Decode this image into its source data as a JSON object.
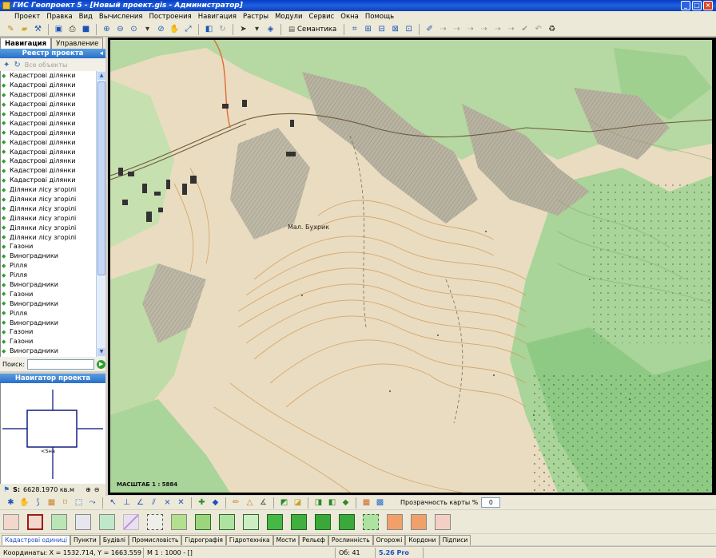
{
  "window": {
    "title": "ГИС Геопроект 5 - [Новый проект.gis - Администратор]"
  },
  "menu": [
    "Проект",
    "Правка",
    "Вид",
    "Вычисления",
    "Построения",
    "Навигация",
    "Растры",
    "Модули",
    "Сервис",
    "Окна",
    "Помощь"
  ],
  "toolbar": {
    "semantic_label": "Семантика"
  },
  "left_tabs": {
    "nav": "Навигация",
    "manage": "Управление"
  },
  "registry": {
    "header": "Реестр проекта",
    "all_objects": "Все объекты",
    "items": [
      "Кадастрові ділянки",
      "Кадастрові ділянки",
      "Кадастрові ділянки",
      "Кадастрові ділянки",
      "Кадастрові ділянки",
      "Кадастрові ділянки",
      "Кадастрові ділянки",
      "Кадастрові ділянки",
      "Кадастрові ділянки",
      "Кадастрові ділянки",
      "Кадастрові ділянки",
      "Кадастрові ділянки",
      "Ділянки лісу згорілі",
      "Ділянки лісу згорілі",
      "Ділянки лісу згорілі",
      "Ділянки лісу згорілі",
      "Ділянки лісу згорілі",
      "Ділянки лісу згорілі",
      "Газони",
      "Виноградники",
      "Рілля",
      "Рілля",
      "Виноградники",
      "Газони",
      "Виноградники",
      "Рілля",
      "Виноградники",
      "Газони",
      "Газони",
      "Виноградники"
    ]
  },
  "search": {
    "label": "Поиск:",
    "value": ""
  },
  "navigator": {
    "header": "Навигатор проекта",
    "center_label": "<Sна"
  },
  "scale_info": {
    "label": "S:",
    "value": "6628.1970 кв.м"
  },
  "map": {
    "scale_label": "МАСШТАБ 1 : 5884",
    "place_label": "Мал. Бухрик"
  },
  "transparency": {
    "label": "Прозрачность карты %",
    "value": "0"
  },
  "swatches": [
    {
      "fill": "#f3d6cc",
      "border": "#999"
    },
    {
      "fill": "#f3d6cc",
      "border": "#9b1c1c"
    },
    {
      "fill": "#b9e6b4",
      "border": "#888"
    },
    {
      "fill": "#e6e6ee",
      "border": "#888"
    },
    {
      "fill": "#bfe8c9",
      "border": "#888"
    },
    {
      "fill": "#e8e0ee",
      "border": "#c5b6d8"
    },
    {
      "fill": "#eeeeea",
      "border": "#555"
    },
    {
      "fill": "#b4df8e",
      "border": "#888"
    },
    {
      "fill": "#9bd67c",
      "border": "#2c6a2c"
    },
    {
      "fill": "#aee2a2",
      "border": "#2c6a2c"
    },
    {
      "fill": "#cdeec4",
      "border": "#2c6a2c"
    },
    {
      "fill": "#46b846",
      "border": "#1f5f1f"
    },
    {
      "fill": "#3fb03f",
      "border": "#1f5f1f"
    },
    {
      "fill": "#39a839",
      "border": "#1f5f1f"
    },
    {
      "fill": "#3ba83b",
      "border": "#1f5f1f"
    },
    {
      "fill": "#aee2a2",
      "border": "#2c6a2c"
    },
    {
      "fill": "#f2a06a",
      "border": "#888"
    },
    {
      "fill": "#f0a06a",
      "border": "#888"
    },
    {
      "fill": "#f4cfc6",
      "border": "#888"
    }
  ],
  "object_tabs": [
    "Кадастрові одиниці",
    "Пункти",
    "Будівлі",
    "Промисловість",
    "Гідрографія",
    "Гідротехніка",
    "Мости",
    "Рельєф",
    "Рослинність",
    "Огорожі",
    "Кордони",
    "Підписи"
  ],
  "status": {
    "coords": "Координаты: X = 1532.714, Y = 1663.559",
    "scale": "М 1 : 1000 - []",
    "objects": "Об: 41",
    "version": "5.26 Pro"
  }
}
